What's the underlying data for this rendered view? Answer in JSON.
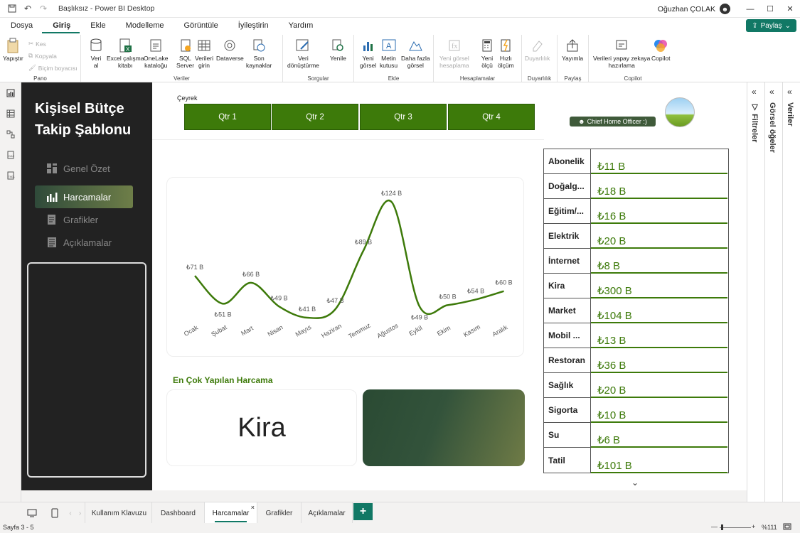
{
  "titlebar": {
    "title": "Başlıksız - Power BI Desktop",
    "user": "Oğuzhan ÇOLAK"
  },
  "menu": [
    "Dosya",
    "Giriş",
    "Ekle",
    "Modelleme",
    "Görüntüle",
    "İyileştirin",
    "Yardım"
  ],
  "share_label": "Paylaş",
  "ribbon": {
    "pano": {
      "label": "Pano",
      "paste": "Yapıştır",
      "cut": "Kes",
      "copy": "Kopyala",
      "format_painter": "Biçim boyacısı"
    },
    "veriler": {
      "label": "Veriler",
      "get_data_1": "Veri",
      "get_data_2": "al",
      "excel_1": "Excel çalışma",
      "excel_2": "kitabı",
      "onelake_1": "OneLake",
      "onelake_2": "kataloğu",
      "sql_1": "SQL",
      "sql_2": "Server",
      "enter_1": "Verileri",
      "enter_2": "girin",
      "dataverse": "Dataverse",
      "recent_1": "Son",
      "recent_2": "kaynaklar"
    },
    "sorgular": {
      "label": "Sorgular",
      "transform_1": "Veri",
      "transform_2": "dönüştürme",
      "refresh": "Yenile"
    },
    "ekle": {
      "label": "Ekle",
      "visual_1": "Yeni",
      "visual_2": "görsel",
      "text_1": "Metin",
      "text_2": "kutusu",
      "more_1": "Daha fazla",
      "more_2": "görsel"
    },
    "hesaplamalar": {
      "label": "Hesaplamalar",
      "calc_1": "Yeni görsel",
      "calc_2": "hesaplama",
      "measure_1": "Yeni",
      "measure_2": "ölçü",
      "quick_1": "Hızlı",
      "quick_2": "ölçüm"
    },
    "duyarlilik": {
      "label": "Duyarlılık",
      "btn": "Duyarlılık"
    },
    "paylas": {
      "label": "Paylaş",
      "btn": "Yayımla"
    },
    "copilot": {
      "label": "Copilot",
      "prep_1": "Verileri yapay zekaya",
      "prep_2": "hazırlama",
      "btn": "Copilot"
    }
  },
  "sidebar": {
    "title_1": "Kişisel Bütçe",
    "title_2": "Takip Şablonu",
    "nav": [
      "Genel Özet",
      "Harcamalar",
      "Grafikler",
      "Açıklamalar"
    ]
  },
  "slicer": {
    "label": "Çeyrek",
    "items": [
      "Qtr 1",
      "Qtr 2",
      "Qtr 3",
      "Qtr 4"
    ]
  },
  "chief_label": "Chief Home Officer :)",
  "colors": {
    "accent": "#3d7a0a",
    "sidebar": "#222222",
    "brand": "#117865"
  },
  "chart_data": {
    "type": "line",
    "categories": [
      "Ocak",
      "Şubat",
      "Mart",
      "Nisan",
      "Mayıs",
      "Haziran",
      "Temmuz",
      "Ağustos",
      "Eylül",
      "Ekim",
      "Kasım",
      "Aralık"
    ],
    "values": [
      71,
      51,
      66,
      49,
      41,
      47,
      89,
      124,
      49,
      50,
      54,
      60
    ],
    "labels": [
      "₺71 B",
      "₺51 B",
      "₺66 B",
      "₺49 B",
      "₺41 B",
      "₺47 B",
      "₺89 B",
      "₺124 B",
      "₺49 B",
      "₺50 B",
      "₺54 B",
      "₺60 B"
    ]
  },
  "top_spend": {
    "heading": "En Çok Yapılan Harcama",
    "value": "Kira"
  },
  "table": {
    "rows": [
      {
        "cat": "Abonelik",
        "val": "₺11 B"
      },
      {
        "cat": "Doğalg...",
        "val": "₺18 B"
      },
      {
        "cat": "Eğitim/...",
        "val": "₺16 B"
      },
      {
        "cat": "Elektrik",
        "val": "₺20 B"
      },
      {
        "cat": "İnternet",
        "val": "₺8 B"
      },
      {
        "cat": "Kira",
        "val": "₺300 B"
      },
      {
        "cat": "Market",
        "val": "₺104 B"
      },
      {
        "cat": "Mobil ...",
        "val": "₺13 B"
      },
      {
        "cat": "Restoran",
        "val": "₺36 B"
      },
      {
        "cat": "Sağlık",
        "val": "₺20 B"
      },
      {
        "cat": "Sigorta",
        "val": "₺10 B"
      },
      {
        "cat": "Su",
        "val": "₺6 B"
      },
      {
        "cat": "Tatil",
        "val": "₺101 B"
      }
    ]
  },
  "panes": [
    "Filtreler",
    "Görsel öğeler",
    "Veriler"
  ],
  "tabs": [
    "Kullanım Klavuzu",
    "Dashboard",
    "Harcamalar",
    "Grafikler",
    "Açıklamalar"
  ],
  "status": {
    "page": "Sayfa 3 - 5",
    "zoom": "%111"
  }
}
